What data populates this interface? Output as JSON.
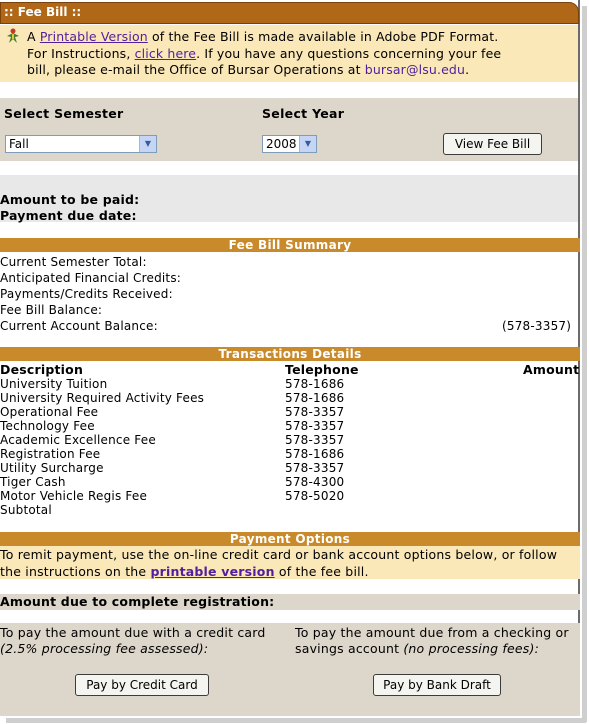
{
  "title": ":: Fee Bill ::",
  "notice": {
    "part1": "A ",
    "link1": "Printable Version",
    "part2": " of the Fee Bill is made available in Adobe PDF Format.",
    "part3": "For Instructions, ",
    "link2": "click here",
    "part4": ". If you have any questions concerning your fee",
    "part5": "bill, please e-mail the Office of Bursar Operations at ",
    "email": "bursar@lsu.edu",
    "part6": "."
  },
  "selector": {
    "semester_label": "Select Semester",
    "semester_value": "Fall",
    "year_label": "Select Year",
    "year_value": "2008",
    "view_button": "View Fee Bill"
  },
  "amount": {
    "to_be_paid_label": "Amount to be paid:",
    "due_date_label": "Payment due date:"
  },
  "summary": {
    "header": "Fee Bill Summary",
    "rows": [
      {
        "label": "Current Semester Total:",
        "value": ""
      },
      {
        "label": "Anticipated Financial Credits:",
        "value": ""
      },
      {
        "label": "Payments/Credits Received:",
        "value": ""
      },
      {
        "label": "Fee Bill Balance:",
        "value": ""
      },
      {
        "label": "Current Account Balance:",
        "value": "(578-3357)"
      }
    ]
  },
  "transactions": {
    "header": "Transactions Details",
    "col_description": "Description",
    "col_telephone": "Telephone",
    "col_amount": "Amount",
    "rows": [
      {
        "description": "University Tuition",
        "telephone": "578-1686"
      },
      {
        "description": "University Required Activity Fees",
        "telephone": "578-1686"
      },
      {
        "description": "Operational Fee",
        "telephone": "578-3357"
      },
      {
        "description": "Technology Fee",
        "telephone": "578-3357"
      },
      {
        "description": "Academic Excellence Fee",
        "telephone": "578-3357"
      },
      {
        "description": "Registration Fee",
        "telephone": "578-1686"
      },
      {
        "description": "Utility Surcharge",
        "telephone": "578-3357"
      },
      {
        "description": "Tiger Cash",
        "telephone": "578-4300"
      },
      {
        "description": "Motor Vehicle Regis Fee",
        "telephone": "578-5020"
      },
      {
        "description": "Subtotal",
        "telephone": ""
      }
    ]
  },
  "payment": {
    "header": "Payment Options",
    "text1": "To remit payment, use the on-line credit card or bank account options below, or follow",
    "text2a": "the instructions on the ",
    "text2link": "printable version",
    "text2b": " of the fee bill.",
    "due_label": "Amount due to complete registration:",
    "credit_text1": "To pay the amount due with a credit card",
    "credit_text2": "(2.5% processing fee assessed):",
    "bank_text1": "To pay the amount due from a checking or",
    "bank_text2a": "savings account ",
    "bank_text2b": "(no processing fees):",
    "credit_button": "Pay by Credit Card",
    "bank_button": "Pay by Bank Draft"
  }
}
